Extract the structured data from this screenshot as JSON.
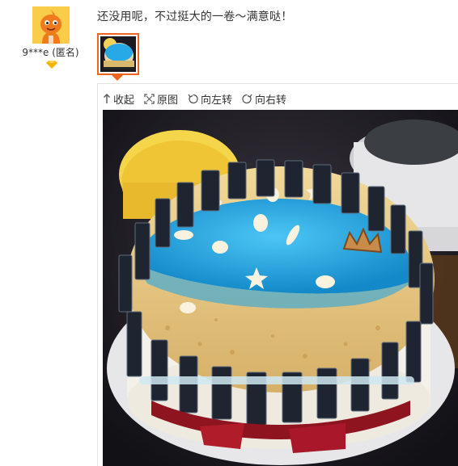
{
  "reviewer": {
    "name": "9***e (匿名)",
    "avatar_icon": "mascot-avatar-icon",
    "badge_icon": "vip-diamond-icon",
    "badge_color": "#f5b400"
  },
  "review": {
    "text": "还没用呢，不过挺大的一卷～满意哒！"
  },
  "viewer": {
    "toolbar": [
      {
        "label": "收起",
        "icon": "collapse-arrow-icon"
      },
      {
        "label": "原图",
        "icon": "fullscreen-icon"
      },
      {
        "label": "向左转",
        "icon": "rotate-left-icon"
      },
      {
        "label": "向右转",
        "icon": "rotate-right-icon"
      }
    ]
  },
  "colors": {
    "accent": "#f0641e",
    "text": "#333333",
    "border": "#e3e3e3"
  }
}
